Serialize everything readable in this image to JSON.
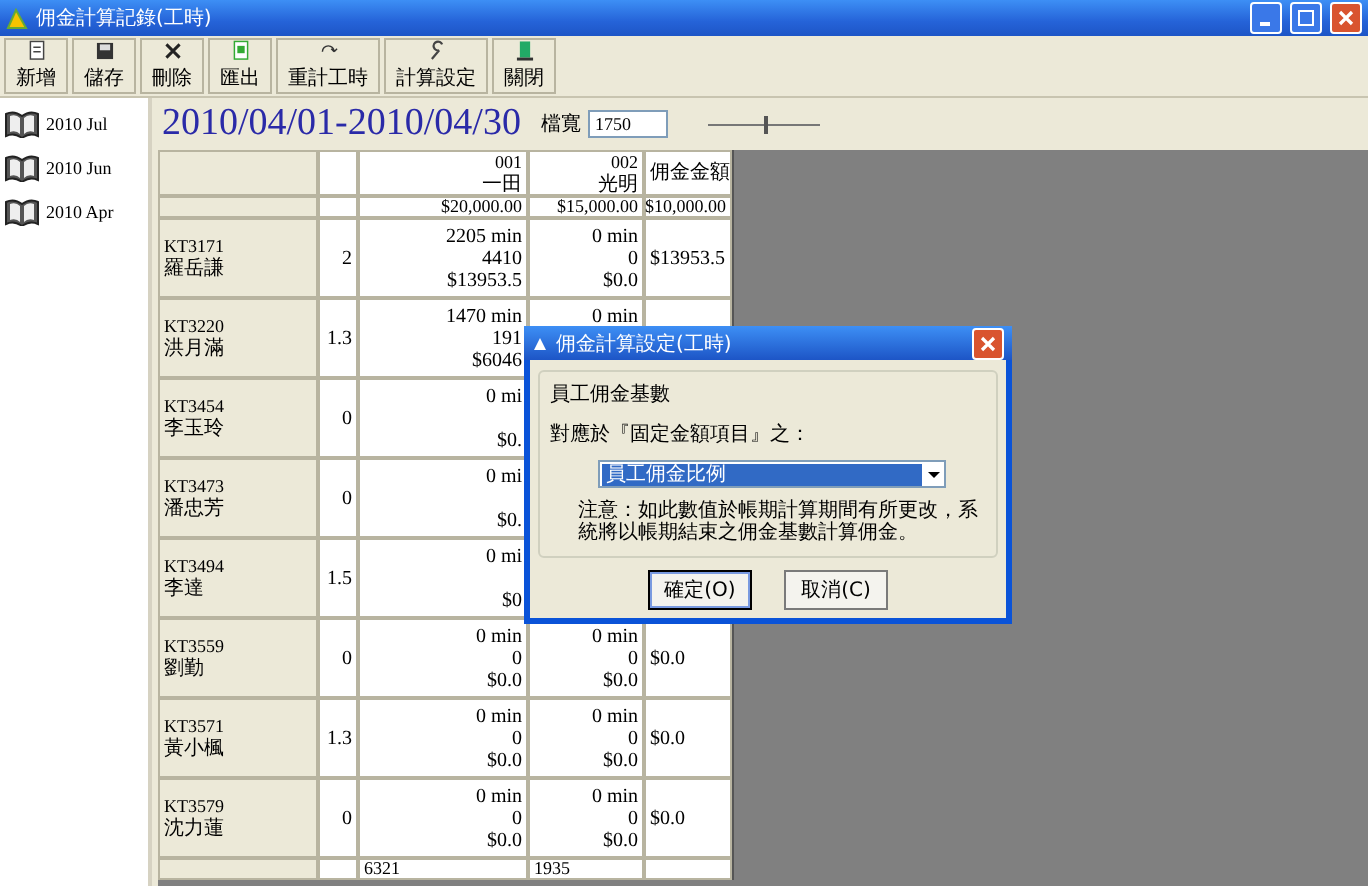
{
  "window": {
    "title": "佣金計算記錄(工時)"
  },
  "toolbar": [
    {
      "label": "新增",
      "kind": "new"
    },
    {
      "label": "儲存",
      "kind": "save"
    },
    {
      "label": "刪除",
      "kind": "delete"
    },
    {
      "label": "匯出",
      "kind": "export"
    },
    {
      "label": "重計工時",
      "kind": "recalc"
    },
    {
      "label": "計算設定",
      "kind": "settings"
    },
    {
      "label": "關閉",
      "kind": "close"
    }
  ],
  "sidebar": {
    "items": [
      {
        "label": "2010 Jul"
      },
      {
        "label": "2010 Jun"
      },
      {
        "label": "2010 Apr"
      }
    ]
  },
  "header": {
    "period": "2010/04/01-2010/04/30",
    "width_label": "檔寬",
    "width_value": "1750",
    "zoom": {
      "level": 0.5
    }
  },
  "table": {
    "columns": [
      {
        "code": "001",
        "name": "一田"
      },
      {
        "code": "002",
        "name": "光明"
      },
      {
        "name": "佣金金額"
      }
    ],
    "amounts": [
      "$20,000.00",
      "$15,000.00",
      "$10,000.00"
    ],
    "rows": [
      {
        "code": "KT3171",
        "name": "羅岳謙",
        "factor": "2",
        "c1": [
          "2205 min",
          "4410",
          "$13953.5"
        ],
        "c2": [
          "0 min",
          "0",
          "$0.0"
        ],
        "commission": "$13953.5"
      },
      {
        "code": "KT3220",
        "name": "洪月滿",
        "factor": "1.3",
        "c1": [
          "1470 min",
          "191",
          "$6046"
        ],
        "c2": [
          "0 min"
        ]
      },
      {
        "code": "KT3454",
        "name": "李玉玲",
        "factor": "0",
        "c1": [
          "0 mi",
          "$0."
        ]
      },
      {
        "code": "KT3473",
        "name": "潘忠芳",
        "factor": "0",
        "c1": [
          "0 mi",
          "$0."
        ]
      },
      {
        "code": "KT3494",
        "name": "李達",
        "factor": "1.5",
        "c1": [
          "0 mi",
          "$0"
        ]
      },
      {
        "code": "KT3559",
        "name": "劉勤",
        "factor": "0",
        "c1": [
          "0 min",
          "0",
          "$0.0"
        ],
        "c2": [
          "0 min",
          "0",
          "$0.0"
        ],
        "commission": "$0.0"
      },
      {
        "code": "KT3571",
        "name": "黃小楓",
        "factor": "1.3",
        "c1": [
          "0 min",
          "0",
          "$0.0"
        ],
        "c2": [
          "0 min",
          "0",
          "$0.0"
        ],
        "commission": "$0.0"
      },
      {
        "code": "KT3579",
        "name": "沈力蓮",
        "factor": "0",
        "c1": [
          "0 min",
          "0",
          "$0.0"
        ],
        "c2": [
          "0 min",
          "0",
          "$0.0"
        ],
        "commission": "$0.0"
      }
    ],
    "totals": [
      "6321",
      "1935"
    ]
  },
  "dialog": {
    "title": "佣金計算設定(工時)",
    "group": "員工佣金基數",
    "label": "對應於『固定金額項目』之：",
    "select_value": "員工佣金比例",
    "note": "注意：如此數值於帳期計算期間有所更改，系統將以帳期結束之佣金基數計算佣金。",
    "buttons": [
      {
        "label": "確定(O)",
        "default": true
      },
      {
        "label": "取消(C)",
        "default": false
      }
    ]
  }
}
